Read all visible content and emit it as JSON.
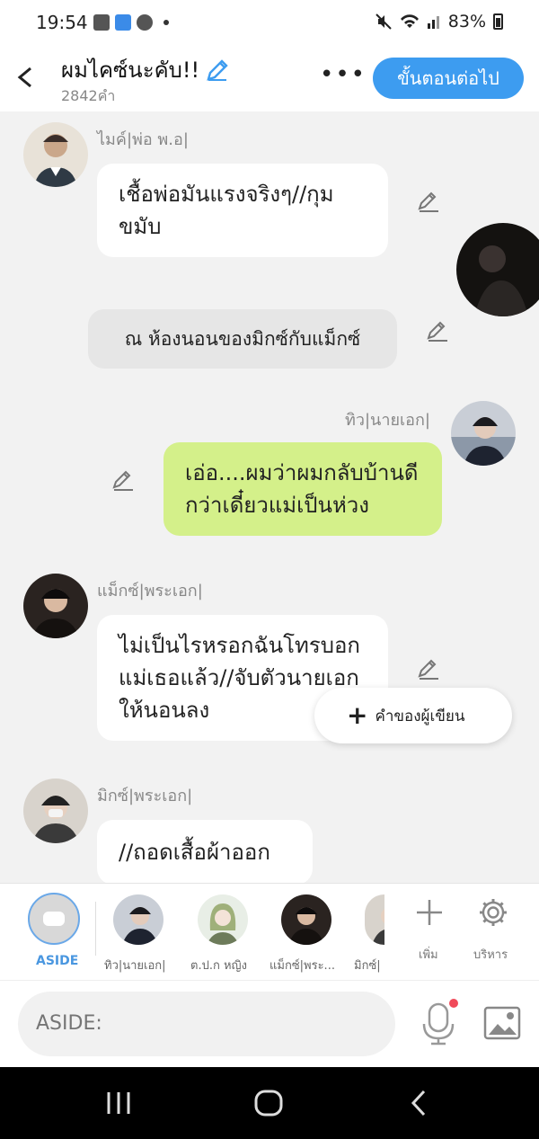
{
  "status_bar": {
    "time": "19:54",
    "battery": "83%"
  },
  "header": {
    "title": "ผมไคซ์นะคับ!!",
    "word_count": "2842คำ",
    "next_button": "ขั้นตอนต่อไป"
  },
  "messages": [
    {
      "sender": "ไมค์|พ่อ พ.อ|",
      "text": "เชื้อพ่อมันแรงจริงๆ//กุมขมับ",
      "style": "left-white"
    },
    {
      "text": "ณ ห้องนอนของมิกซ์กับแม็กซ์",
      "style": "narration"
    },
    {
      "sender": "ทิว|นายเอก|",
      "text": "เอ่อ....ผมว่าผมกลับบ้านดีกว่าเดี๋ยวแม่เป็นห่วง",
      "style": "right-green"
    },
    {
      "sender": "แม็กซ์|พระเอก|",
      "text": "ไม่เป็นไรหรอกฉันโทรบอกแม่เธอแล้ว//จับตัวนายเอกให้นอนลง",
      "style": "left-white"
    },
    {
      "sender": "มิกซ์|พระเอก|",
      "text": "//ถอดเสื้อผ้าออก",
      "style": "left-white"
    }
  ],
  "writer_button": "คำของผู้เขียน",
  "tray": {
    "aside_label": "ASIDE",
    "characters": [
      "ทิว|นายเอก|",
      "ต.ป.ก หญิง",
      "แม็กซ์|พระ...",
      "มิกซ์|"
    ],
    "add_label": "เพิ่ม",
    "manage_label": "บริหาร"
  },
  "input": {
    "placeholder": "ASIDE:"
  },
  "colors": {
    "accent": "#3d9cf0",
    "green_bubble": "#d4f08a",
    "background": "#f2f2f2"
  }
}
